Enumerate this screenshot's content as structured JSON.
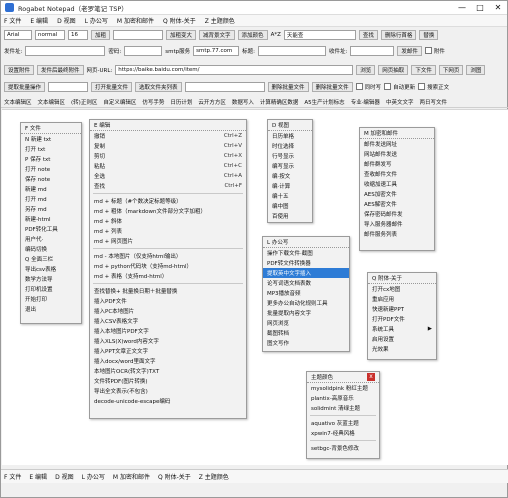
{
  "window": {
    "title": "Rogabet Notepad（老罗笔记 TSP）",
    "controls": [
      "—",
      "□",
      "✕"
    ]
  },
  "menubar": [
    "F 文件",
    "E 编辑",
    "D 视图",
    "L 办公写",
    "M 加密和邮件",
    "Q 附体-关于",
    "Z 主题颜色"
  ],
  "toolbar1": {
    "font": "Arial",
    "style": "normal",
    "size": "16",
    "b1": "加粗",
    "b2": "加粗变大",
    "b3": "减背景文字",
    "b4": "添加颜色",
    "az": "A*Z",
    "find": "天能查",
    "b5": "查找",
    "b6": "删除行首格",
    "b7": "替换"
  },
  "toolbar2": {
    "sender_label": "发件址:",
    "pwd_label": "密码:",
    "smtp_label": "smtp服务",
    "smtp_value": "smtp.77.com",
    "title_label": "标题:",
    "recv_label": "收件址:",
    "send_btn": "发邮件",
    "attach_label": "附件"
  },
  "toolbar3": {
    "b1": "设置附件",
    "b2": "发件后最终附件",
    "url_label": "网页-URL:",
    "url_value": "https://baike.baidu.com/item/",
    "b3": "浏览",
    "b4": "网页抽取",
    "b5": "下文件",
    "b6": "下网页",
    "b7": "浏图"
  },
  "toolbar4": {
    "b1": "提取批量操作",
    "b2": "打开批量文件",
    "b3": "选取文件夹列表",
    "b4": "删除批量文件",
    "b5": "删除批量文件",
    "c1": "同时写",
    "c2": "自动更新",
    "c3": "搜索正文"
  },
  "tabs": [
    "文本编辑区",
    "文本编辑区",
    "(转)正则区",
    "自定义编辑区",
    "仿写手势",
    "日历计划",
    "云开方方区",
    "数据写入",
    "计算精确区数据",
    "A5生产计划标志",
    "专业·编辑器",
    "中英文文字",
    "两日写文件"
  ],
  "menu_file": {
    "title": "F 文件",
    "items": [
      "N 新建 txt",
      "打开 txt",
      "P 保存 txt",
      "打开 note",
      "保存 note",
      "新建 md",
      "打开 md",
      "另存 md",
      "新建-html",
      "PDF转化工具",
      "用户代·",
      "编码切换",
      "Q 全面三栏",
      "导出csv表格",
      "数学方法导",
      "打印机设置",
      "开始打印",
      "退出"
    ]
  },
  "menu_edit": {
    "title": "E 编辑",
    "items": [
      {
        "label": "撤销",
        "sc": "Ctrl+Z"
      },
      {
        "label": "复制",
        "sc": "Ctrl+V"
      },
      {
        "label": "剪切",
        "sc": "Ctrl+X"
      },
      {
        "label": "粘贴",
        "sc": "Ctrl+C"
      },
      {
        "label": "全选",
        "sc": "Ctrl+A"
      },
      {
        "label": "查找",
        "sc": "Ctrl+F"
      }
    ],
    "md": [
      "md + 标题（#个数决定标题等级）",
      "md + 粗体（markdown文件部分文字加粗）",
      "md + 斜体",
      "md + 列表",
      "md + 网页图片"
    ],
    "md2": [
      "md - 本地图片（仅支持html输出）",
      "md + python代码块（支持md-html）",
      "md + 表格（支持md-html）"
    ],
    "tools": [
      "查找替换+ 批量换日期＋批量替换",
      "插入PDF文件",
      "插入PC本地图片",
      "插入CSV表格文字",
      "插入本地图片PDF文字",
      "插入XLS(X)word内容文字",
      "插入PPT文章正文文字",
      "插入docx/word里面文字",
      "本地图片OCR(转文字)TXT",
      "文件转PDF(图片转换)",
      "导出全文表示(不包含)",
      "decode-unicode-escape编码"
    ]
  },
  "menu_view": {
    "title": "D 视图",
    "items": [
      "日历单格",
      "时位选择",
      "行号显示",
      "编写显示",
      "编·按文",
      "编·计算",
      "编十五",
      "编中图",
      "百使用"
    ]
  },
  "menu_office": {
    "title": "L 办公写",
    "items": [
      "操作下载文件·截图",
      "PDF转文件转换器",
      "提取英中文字插入",
      "论写词语文档表数",
      "MP3播放音频",
      "更多办公自动化规则工具",
      "批量提取内容文字",
      "网页浏览",
      "截图转档",
      "图文写作"
    ],
    "selected": 2
  },
  "menu_mail": {
    "title": "M 加密和邮件",
    "items": [
      "邮件发送网址",
      "网站邮件发送",
      "邮件群发写",
      "查收邮件文件",
      "收缩加速工具",
      "AES加密文件",
      "AES解密文件",
      "保存密码邮件发",
      "导入服务器邮件",
      "邮件服务列表"
    ]
  },
  "menu_about": {
    "title": "Q 附体-关于",
    "items": [
      "打开cx地图",
      "重启应用",
      "快速新建PPT",
      "打开PDF文件",
      "系统工具",
      "启用设置",
      "光效果"
    ]
  },
  "menu_theme": {
    "title": "主题颜色",
    "close": "x",
    "items": [
      "mysolidpink 粉红主题",
      "plantix-高原音乐",
      "solidmint 清绿主题",
      "aquativo 灰蓝主题",
      "xpwin7-经典风格",
      "setbgc-背景色修改"
    ]
  },
  "statusbar": [
    "F 文件",
    "E 编辑",
    "D 视图",
    "L 办公写",
    "M 加密和邮件",
    "Q 附体-关于",
    "Z 主题颜色"
  ]
}
